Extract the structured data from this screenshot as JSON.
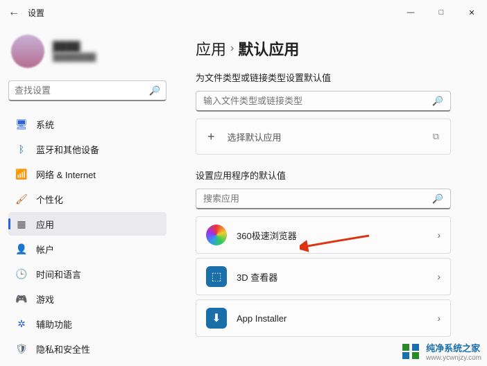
{
  "window": {
    "title": "设置",
    "controls": {
      "min": "—",
      "max": "□",
      "close": "✕"
    }
  },
  "profile": {
    "name": "████",
    "sub": "████████"
  },
  "search": {
    "placeholder": "查找设置",
    "icon": "🔍"
  },
  "nav": [
    {
      "label": "系统",
      "icon": "🖥",
      "color": "#2a62da",
      "active": false
    },
    {
      "label": "蓝牙和其他设备",
      "icon": "ᛒ",
      "color": "#1a6faa",
      "active": false
    },
    {
      "label": "网络 & Internet",
      "icon": "📶",
      "color": "#444",
      "active": false
    },
    {
      "label": "个性化",
      "icon": "🖌",
      "color": "#c05a1a",
      "active": false
    },
    {
      "label": "应用",
      "icon": "▦",
      "color": "#555",
      "active": true
    },
    {
      "label": "帐户",
      "icon": "👤",
      "color": "#4a7a4a",
      "active": false
    },
    {
      "label": "时间和语言",
      "icon": "🕒",
      "color": "#555",
      "active": false
    },
    {
      "label": "游戏",
      "icon": "🎮",
      "color": "#7aa",
      "active": false
    },
    {
      "label": "辅助功能",
      "icon": "✲",
      "color": "#2a62da",
      "active": false
    },
    {
      "label": "隐私和安全性",
      "icon": "🛡",
      "color": "#5a6a7a",
      "active": false
    }
  ],
  "breadcrumb": {
    "root": "应用",
    "sep": "›",
    "current": "默认应用"
  },
  "section1": {
    "label": "为文件类型或链接类型设置默认值",
    "input_placeholder": "输入文件类型或链接类型",
    "choose_label": "选择默认应用",
    "open_glyph": "⧉"
  },
  "section2": {
    "label": "设置应用程序的默认值",
    "search_placeholder": "搜索应用"
  },
  "apps": [
    {
      "name": "360极速浏览器",
      "icon_bg": "#fff",
      "icon_text": "◯",
      "icon_color": "conic"
    },
    {
      "name": "3D 查看器",
      "icon_bg": "#1a6faa",
      "icon_text": "⬚",
      "icon_color": "#fff"
    },
    {
      "name": "App Installer",
      "icon_bg": "#1a6faa",
      "icon_text": "⬇",
      "icon_color": "#fff"
    }
  ],
  "watermark": {
    "text": "纯净系统之家",
    "url": "www.ycwnjzy.com"
  }
}
